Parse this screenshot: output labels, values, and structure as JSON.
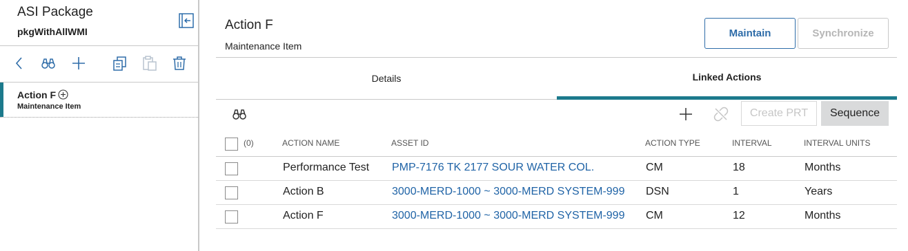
{
  "sidebar": {
    "title": "ASI Package",
    "subtitle": "pkgWithAllWMI",
    "item": {
      "title": "Action F",
      "subtitle": "Maintenance Item"
    }
  },
  "header": {
    "title": "Action F",
    "subtitle": "Maintenance Item",
    "maintain_label": "Maintain",
    "synchronize_label": "Synchronize"
  },
  "tabs": [
    {
      "label": "Details"
    },
    {
      "label": "Linked Actions"
    }
  ],
  "grid": {
    "create_prt_label": "Create PRT",
    "sequence_label": "Sequence",
    "selected_count": "(0)",
    "columns": [
      "ACTION NAME",
      "ASSET ID",
      "ACTION TYPE",
      "INTERVAL",
      "INTERVAL UNITS"
    ],
    "rows": [
      {
        "name": "Performance Test",
        "asset": "PMP-7176 TK 2177 SOUR WATER COL.",
        "type": "CM",
        "interval": "18",
        "units": "Months"
      },
      {
        "name": "Action B",
        "asset": "3000-MERD-1000 ~ 3000-MERD SYSTEM-999",
        "type": "DSN",
        "interval": "1",
        "units": "Years"
      },
      {
        "name": "Action F",
        "asset": "3000-MERD-1000 ~ 3000-MERD SYSTEM-999",
        "type": "CM",
        "interval": "12",
        "units": "Months"
      }
    ]
  },
  "colors": {
    "accent": "#1c7a8c",
    "link": "#1f63a6",
    "primary_button": "#2e6ca8"
  },
  "icons": [
    "collapse-panel-icon",
    "back-chevron-icon",
    "binoculars-icon",
    "plus-icon",
    "copy-icon",
    "paste-icon",
    "trash-icon",
    "add-circle-icon",
    "unlink-icon"
  ]
}
